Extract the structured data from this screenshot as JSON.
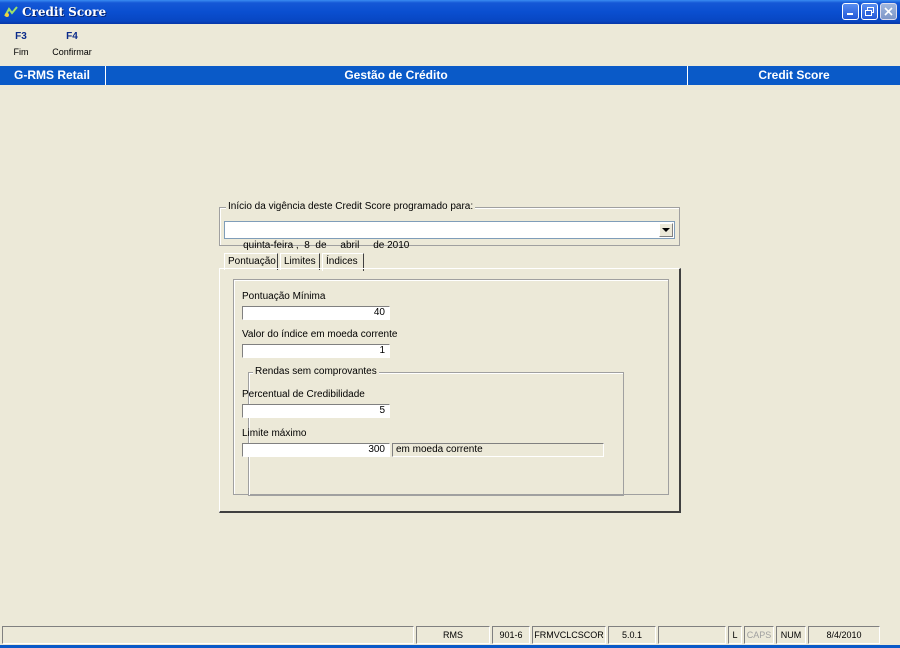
{
  "window": {
    "title": "Credit Score",
    "icon": "app-icon"
  },
  "toolbar": {
    "keys": [
      {
        "key": "F3",
        "label": "Fim"
      },
      {
        "key": "F4",
        "label": "Confirmar"
      }
    ]
  },
  "header": {
    "left": "G-RMS Retail",
    "center": "Gestão de Crédito",
    "right": "Credit Score"
  },
  "start_date": {
    "legend": "Início da vigência deste Credit Score programado para:",
    "value": "quinta-feira ,  8  de     abril     de 2010"
  },
  "tabs": {
    "items": [
      "Pontuação",
      "Limites",
      "Índices"
    ],
    "active": "Índices"
  },
  "indices": {
    "min_score_label": "Pontuação Mínima",
    "min_score_value": "40",
    "index_value_label": "Valor do índice em moeda corrente",
    "index_value": "1",
    "no_proof_group": "Rendas sem comprovantes",
    "credibility_label": "Percentual de Credibilidade",
    "credibility_value": "5",
    "max_limit_label": "Limite máximo",
    "max_limit_value": "300",
    "max_limit_unit": "em moeda corrente"
  },
  "statusbar": {
    "cells": [
      "RMS",
      "901-6",
      "FRMVCLCSCOR",
      "5.0.1",
      "",
      "L",
      "CAPS",
      "NUM",
      "8/4/2010"
    ]
  }
}
